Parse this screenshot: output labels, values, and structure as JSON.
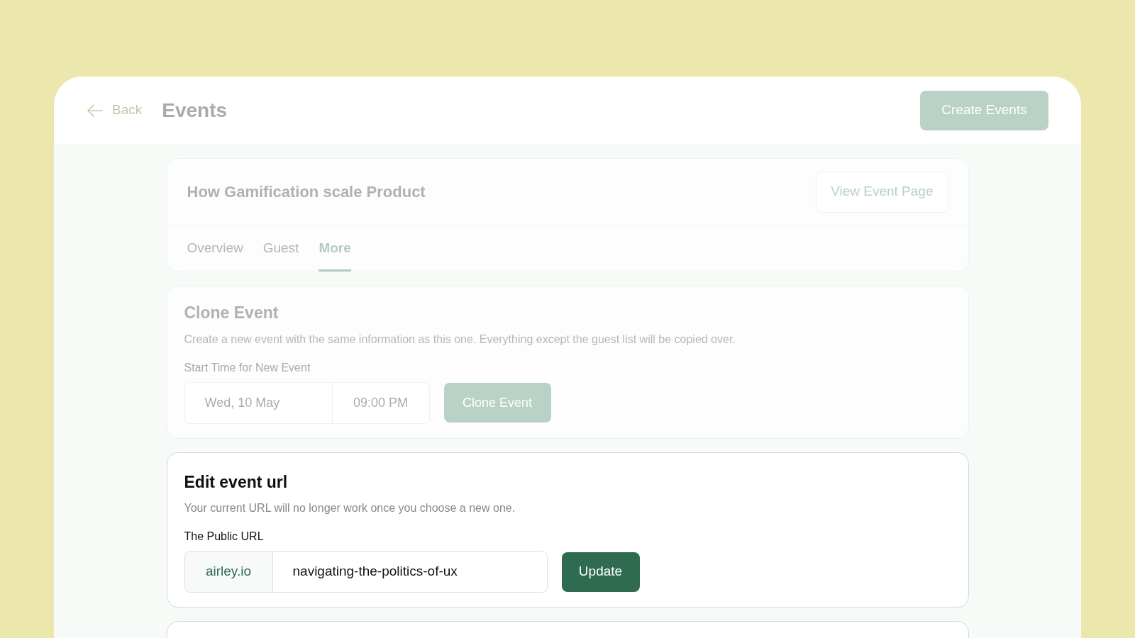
{
  "header": {
    "back": "Back",
    "title": "Events",
    "create_button": "Create Events"
  },
  "event": {
    "title": "How Gamification scale Product",
    "view_button": "View Event Page",
    "tabs": [
      {
        "label": "Overview",
        "selected": false
      },
      {
        "label": "Guest",
        "selected": false
      },
      {
        "label": "More",
        "selected": true
      }
    ]
  },
  "clone_event": {
    "focused": false,
    "title": "Clone Event",
    "description": "Create a new event with the same information as this one. Everything except the guest list will be copied over.",
    "field_label": "Start Time for New Event",
    "date": "Wed, 10 May",
    "time": "09:00 PM",
    "button": "Clone Event"
  },
  "edit_url": {
    "focused": true,
    "title": "Edit event url",
    "description": "Your current URL will no longer work once you choose a new one.",
    "field_label": "The Public URL",
    "domain": "airley.io",
    "slug": "navigating-the-politics-of-ux",
    "button": "Update"
  }
}
